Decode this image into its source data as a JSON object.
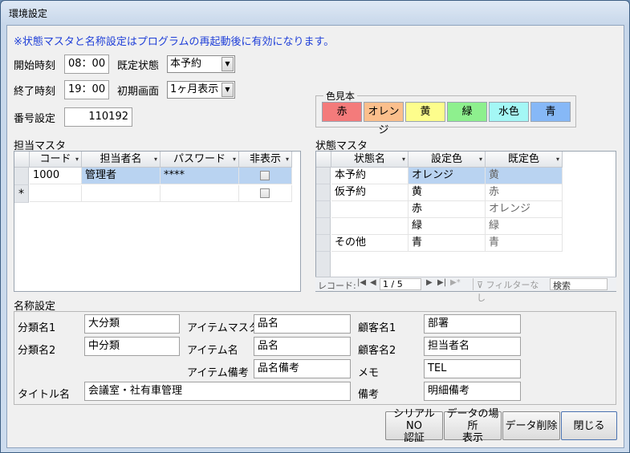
{
  "window": {
    "title": "環境設定"
  },
  "notice": "※状態マスタと名称設定はプログラムの再起動後に有効になります。",
  "settings": {
    "start_time_label": "開始時刻",
    "start_time": "08：00",
    "end_time_label": "終了時刻",
    "end_time": "19：00",
    "default_status_label": "既定状態",
    "default_status": "本予約",
    "initial_view_label": "初期画面",
    "initial_view": "1ヶ月表示",
    "number_label": "番号設定",
    "number_value": "110192"
  },
  "color_sample": {
    "title": "色見本",
    "swatches": [
      {
        "label": "赤",
        "color": "#f47b7b"
      },
      {
        "label": "オレンジ",
        "color": "#fbbf8c"
      },
      {
        "label": "黄",
        "color": "#fdfd8c"
      },
      {
        "label": "緑",
        "color": "#8ef08e"
      },
      {
        "label": "水色",
        "color": "#a4f7f5"
      },
      {
        "label": "青",
        "color": "#86b8f7"
      }
    ]
  },
  "staff_master": {
    "title": "担当マスタ",
    "headers": [
      "コード",
      "担当者名",
      "パスワード",
      "非表示"
    ],
    "rows": [
      {
        "code": "1000",
        "name": "管理者",
        "password": "****"
      }
    ],
    "new_row_marker": "*"
  },
  "status_master": {
    "title": "状態マスタ",
    "headers": [
      "状態名",
      "設定色",
      "既定色"
    ],
    "rows": [
      {
        "name": "本予約",
        "color": "オレンジ",
        "default": "黄"
      },
      {
        "name": "仮予約",
        "color": "黄",
        "default": "赤"
      },
      {
        "name": "",
        "color": "赤",
        "default": "オレンジ"
      },
      {
        "name": "",
        "color": "緑",
        "default": "緑"
      },
      {
        "name": "その他",
        "color": "青",
        "default": "青"
      }
    ],
    "nav": {
      "record_label": "レコード:",
      "position": "1 / 5",
      "filter": "フィルターなし",
      "search": "検索"
    }
  },
  "names": {
    "title": "名称設定",
    "cat1_label": "分類名1",
    "cat1": "大分類",
    "cat2_label": "分類名2",
    "cat2": "中分類",
    "item_master_label": "アイテムマスタ",
    "item_master": "品名",
    "item_name_label": "アイテム名",
    "item_name": "品名",
    "item_note_label": "アイテム備考",
    "item_note": "品名備考",
    "cust1_label": "顧客名1",
    "cust1": "部署",
    "cust2_label": "顧客名2",
    "cust2": "担当者名",
    "memo_label": "メモ",
    "memo": "TEL",
    "note_label": "備考",
    "note": "明細備考",
    "title_label": "タイトル名",
    "title_value": "会議室・社有車管理"
  },
  "buttons": {
    "serial_line1": "シリアルNO",
    "serial_line2": "認証",
    "data_loc_line1": "データの場所",
    "data_loc_line2": "表示",
    "delete": "データ削除",
    "close": "閉じる"
  }
}
